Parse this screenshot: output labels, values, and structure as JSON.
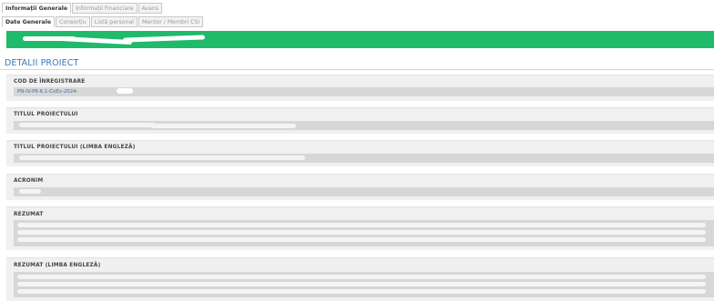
{
  "tabs_top": [
    {
      "label": "Informații Generale",
      "active": true
    },
    {
      "label": "Informații Financiare",
      "active": false
    },
    {
      "label": "Avans",
      "active": false
    }
  ],
  "tabs_second": [
    {
      "label": "Date Generale",
      "active": true
    },
    {
      "label": "Consorțiu",
      "active": false
    },
    {
      "label": "Listă personal",
      "active": false
    },
    {
      "label": "Mentor / Membri CSI",
      "active": false
    }
  ],
  "section_title": "DETALII PROIECT",
  "fields": {
    "cod_label": "COD DE ÎNREGISTRARE",
    "cod_value": "PN-IV-P6-6.1-CoEx-2024-",
    "titlu_label": "TITLUL PROIECTULUI",
    "titlu_en_label": "TITLUL PROIECTULUI (LIMBA ENGLEZĂ)",
    "acronim_label": "ACRONIM",
    "rezumat_label": "REZUMAT",
    "rezumat_en_label": "REZUMAT (LIMBA ENGLEZĂ)"
  },
  "colors": {
    "banner": "#1fba6a",
    "section_title": "#3a78b6",
    "value_text": "#3a6ea8"
  }
}
